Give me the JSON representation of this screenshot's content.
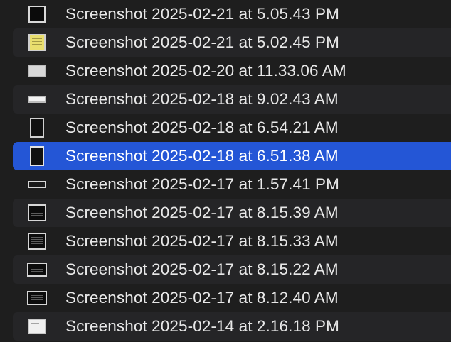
{
  "files": [
    {
      "name": "Screenshot 2025-02-21 at 5.05.43 PM",
      "thumbnail": "dark-square-screenshot-icon"
    },
    {
      "name": "Screenshot 2025-02-21 at 5.02.45 PM",
      "thumbnail": "yellow-document-screenshot-icon"
    },
    {
      "name": "Screenshot 2025-02-20 at 11.33.06 AM",
      "thumbnail": "wide-light-screenshot-icon"
    },
    {
      "name": "Screenshot 2025-02-18 at 9.02.43 AM",
      "thumbnail": "thin-strip-screenshot-icon"
    },
    {
      "name": "Screenshot 2025-02-18 at 6.54.21 AM",
      "thumbnail": "tall-dark-screenshot-icon"
    },
    {
      "name": "Screenshot 2025-02-18 at 6.51.38 AM",
      "thumbnail": "tall-dark-screenshot-icon",
      "selected": true
    },
    {
      "name": "Screenshot 2025-02-17 at 1.57.41 PM",
      "thumbnail": "thin-strip-screenshot-icon"
    },
    {
      "name": "Screenshot 2025-02-17 at 8.15.39 AM",
      "thumbnail": "terminal-screenshot-icon"
    },
    {
      "name": "Screenshot 2025-02-17 at 8.15.33 AM",
      "thumbnail": "terminal-screenshot-icon"
    },
    {
      "name": "Screenshot 2025-02-17 at 8.15.22 AM",
      "thumbnail": "terminal-wide-screenshot-icon"
    },
    {
      "name": "Screenshot 2025-02-17 at 8.12.40 AM",
      "thumbnail": "terminal-wide-screenshot-icon"
    },
    {
      "name": "Screenshot 2025-02-14 at 2.16.18 PM",
      "thumbnail": "light-document-screenshot-icon"
    }
  ],
  "colors": {
    "background": "#1e1e1e",
    "alternate_row": "#252527",
    "selection": "#2456d6",
    "text": "#e8e8e8"
  }
}
